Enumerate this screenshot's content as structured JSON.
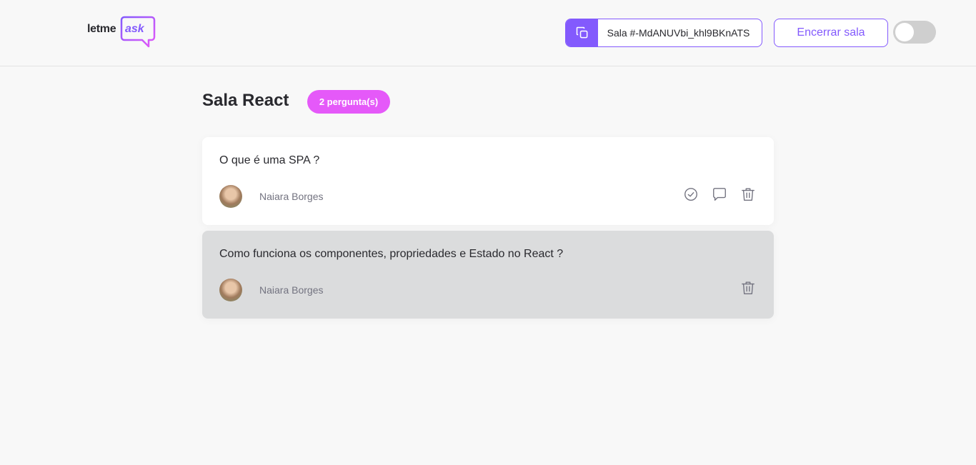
{
  "header": {
    "logo_letme": "letme",
    "logo_ask": "ask",
    "room_code_label": "Sala #-MdANUVbi_khl9BKnATS",
    "close_room_label": "Encerrar sala"
  },
  "room": {
    "title": "Sala React",
    "question_count": "2 pergunta(s)"
  },
  "questions": [
    {
      "content": "O que é uma SPA ?",
      "author": "Naiara Borges"
    },
    {
      "content": "Como funciona os componentes, propriedades e Estado no React ?",
      "author": "Naiara Borges"
    }
  ],
  "colors": {
    "accent": "#835afd",
    "badge": "#e559f9",
    "text": "#29292e",
    "muted": "#737380",
    "highlight_bg": "#dbdcdd"
  },
  "icons": {
    "copy": "copy-icon",
    "check": "check-circle-icon",
    "answer": "chat-bubble-icon",
    "delete": "trash-icon"
  }
}
